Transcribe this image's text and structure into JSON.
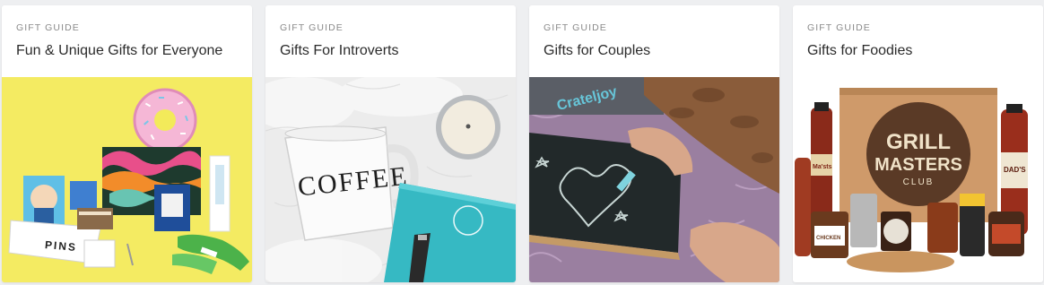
{
  "cards": [
    {
      "eyebrow": "GIFT GUIDE",
      "title": "Fun & Unique Gifts for Everyone",
      "image": {
        "description": "Colorful subscription box items on yellow background",
        "bg_color": "#f3ea5a"
      },
      "photo_text": {
        "pins": "PINS"
      }
    },
    {
      "eyebrow": "GIFT GUIDE",
      "title": "Gifts For Introverts",
      "image": {
        "description": "Coffee mug, candle and teal journal on white fur",
        "bg_color": "#ececec"
      },
      "photo_text": {
        "mug": "COFFEE"
      }
    },
    {
      "eyebrow": "GIFT GUIDE",
      "title": "Gifts for Couples",
      "image": {
        "description": "Hand drawing a heart on chalkboard on purple fur rug",
        "bg_color": "#9a7fa0"
      },
      "photo_text": {
        "box_logo": "Crateljoy"
      }
    },
    {
      "eyebrow": "GIFT GUIDE",
      "title": "Gifts for Foodies",
      "image": {
        "description": "Grill Masters Club box with sauces and spice jars",
        "bg_color": "#ffffff"
      },
      "photo_text": {
        "box_line1": "GRILL",
        "box_line2": "MASTERS",
        "box_line3": "CLUB",
        "bottle_left": "Ma'sts",
        "bottle_right": "DAD'S",
        "jar": "CHICKEN"
      }
    }
  ]
}
